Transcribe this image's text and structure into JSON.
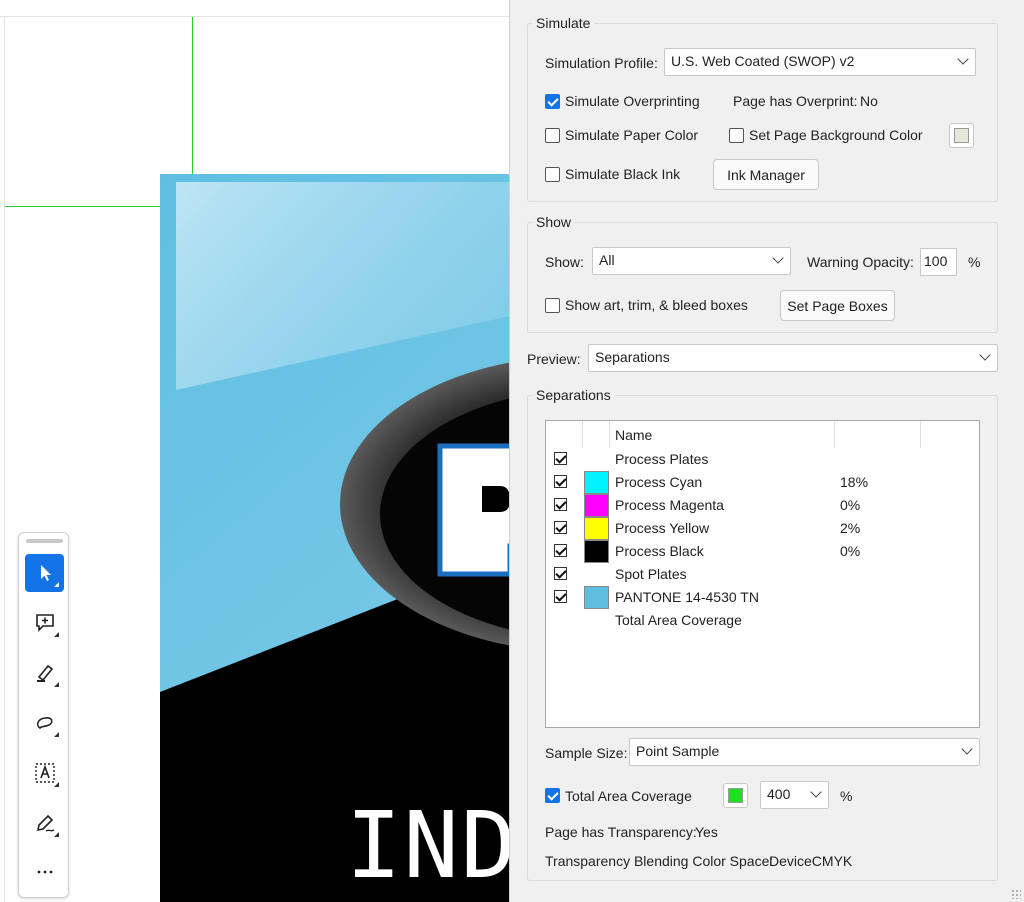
{
  "simulate": {
    "legend": "Simulate",
    "profile_label": "Simulation Profile:",
    "profile_value": "U.S. Web Coated (SWOP) v2",
    "overprinting_label": "Simulate Overprinting",
    "overprinting_checked": true,
    "page_has_overprint_label": "Page has Overprint:",
    "page_has_overprint_value": "No",
    "paper_color_label": "Simulate Paper Color",
    "page_bg_label": "Set Page Background Color",
    "black_ink_label": "Simulate Black Ink",
    "ink_manager_label": "Ink Manager"
  },
  "show": {
    "legend": "Show",
    "show_label": "Show:",
    "show_value": "All",
    "warning_opacity_label": "Warning Opacity:",
    "warning_opacity_value": "100",
    "percent": "%",
    "boxes_label": "Show art, trim, & bleed boxes",
    "set_page_boxes_label": "Set Page Boxes"
  },
  "preview": {
    "label": "Preview:",
    "value": "Separations"
  },
  "separations": {
    "legend": "Separations",
    "column_name": "Name",
    "rows": [
      {
        "checked": true,
        "color": "",
        "name": "Process Plates",
        "coverage": ""
      },
      {
        "checked": true,
        "color": "#00f2ff",
        "name": "Process Cyan",
        "coverage": "18%"
      },
      {
        "checked": true,
        "color": "#ff00ff",
        "name": "Process Magenta",
        "coverage": "0%"
      },
      {
        "checked": true,
        "color": "#ffff00",
        "name": "Process Yellow",
        "coverage": "2%"
      },
      {
        "checked": true,
        "color": "#000000",
        "name": "Process Black",
        "coverage": "0%"
      },
      {
        "checked": true,
        "color": "",
        "name": "Spot Plates",
        "coverage": ""
      },
      {
        "checked": true,
        "color": "#5ebfe0",
        "name": "PANTONE 14-4530 TN",
        "coverage": ""
      },
      {
        "checked": false,
        "color": "",
        "name": "Total Area Coverage",
        "coverage": ""
      }
    ]
  },
  "sample": {
    "label": "Sample Size:",
    "value": "Point Sample"
  },
  "coverage": {
    "label": "Total Area Coverage",
    "checked": true,
    "swatch_color": "#1fe01f",
    "value": "400",
    "percent": "%"
  },
  "info": {
    "transparency_label": "Page has Transparency:",
    "transparency_value": "Yes",
    "blend_label": "Transparency Blending Color Space:",
    "blend_value": "DeviceCMYK"
  },
  "artwork": {
    "visible_text": "IND",
    "logo_letter": "P",
    "sky_color": "#7ec8e6",
    "dark_color": "#000000",
    "accent_blue": "#1b6fc0"
  },
  "tools": [
    {
      "name": "select-tool",
      "icon": "arrow-icon",
      "active": true
    },
    {
      "name": "add-comment-tool",
      "icon": "comment-plus-icon",
      "active": false
    },
    {
      "name": "highlight-tool",
      "icon": "highlighter-icon",
      "active": false
    },
    {
      "name": "freehand-tool",
      "icon": "lasso-icon",
      "active": false
    },
    {
      "name": "text-box-tool",
      "icon": "text-box-icon",
      "active": false
    },
    {
      "name": "sign-tool",
      "icon": "pen-sign-icon",
      "active": false
    },
    {
      "name": "more-tools",
      "icon": "more-icon",
      "active": false
    }
  ]
}
